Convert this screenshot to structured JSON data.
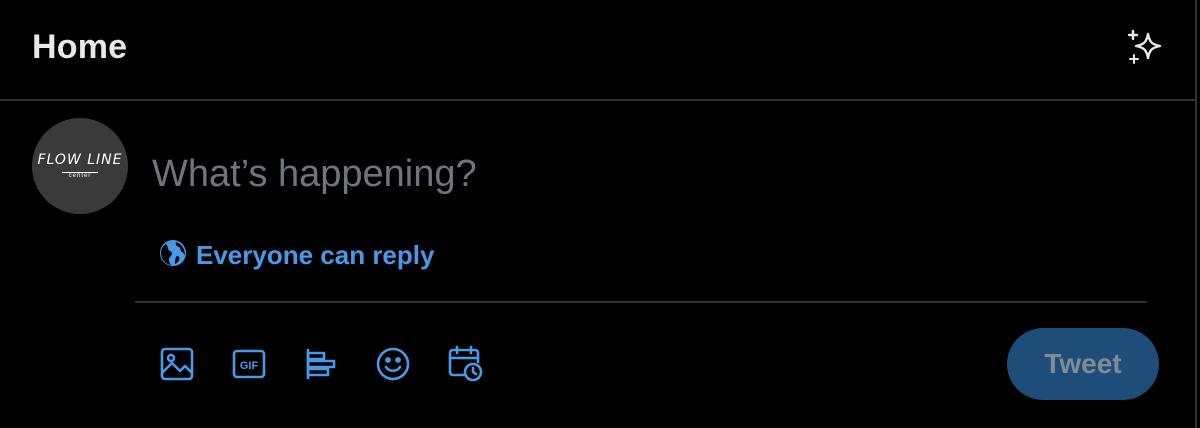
{
  "header": {
    "title": "Home",
    "top_tweets_icon": "sparkle-icon"
  },
  "composer": {
    "avatar_logo_text": "FLOW LINE",
    "avatar_logo_subtext": "center",
    "placeholder": "What’s happening?",
    "reply_setting_icon": "globe-icon",
    "reply_setting_label": "Everyone can reply",
    "toolbar_icons": [
      "media-icon",
      "gif-icon",
      "poll-icon",
      "emoji-icon",
      "schedule-icon"
    ],
    "tweet_button_label": "Tweet"
  },
  "colors": {
    "background": "#000000",
    "text_primary": "#e7e9ea",
    "placeholder": "#6e767d",
    "accent": "#4a99e9",
    "tweet_button_disabled_bg": "#1f4d7a",
    "border": "#2f3336"
  }
}
